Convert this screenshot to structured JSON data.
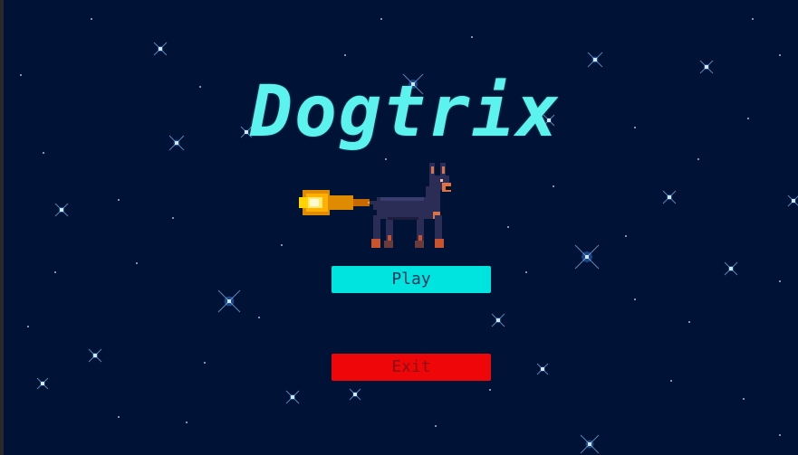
{
  "game": {
    "title": "Dogtrix"
  },
  "menu": {
    "play_label": "Play",
    "exit_label": "Exit"
  },
  "colors": {
    "background": "#001236",
    "title": "#5cf2ee",
    "play_button": "#00e4df",
    "exit_button": "#ee0609",
    "star": "#9fd0ff"
  },
  "hero": {
    "character": "doberman-dog-sprite",
    "projectile": "fireball-icon"
  }
}
